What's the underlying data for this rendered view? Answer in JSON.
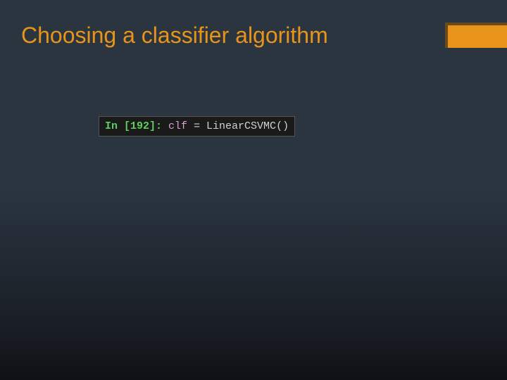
{
  "slide": {
    "title": "Choosing a classifier algorithm"
  },
  "code": {
    "prompt": "In [192]: ",
    "var": "clf",
    "equals": " = ",
    "call": "LinearCSVMC()"
  }
}
